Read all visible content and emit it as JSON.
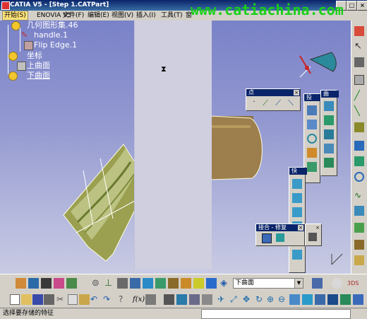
{
  "window": {
    "title": "CATIA V5 - [Step 1.CATPart]",
    "watermark": "www.catiachina.com"
  },
  "menu": {
    "items": [
      "开始(S)",
      "ENOVIA V5",
      "文件(F)",
      "编辑(E)",
      "视图(V)",
      "插入(I)",
      "工具(T)",
      "窗"
    ],
    "active_index": 0
  },
  "tree": {
    "items": [
      {
        "label": "几何图形集.46",
        "icon": "geometric-set-icon"
      },
      {
        "label": "handle.1",
        "icon": "curve-icon"
      },
      {
        "label": "Flip Edge.1",
        "icon": "flip-edge-icon"
      },
      {
        "label": "坐标",
        "icon": "axis-system-icon"
      },
      {
        "label": "上曲面",
        "icon": "surface-icon"
      },
      {
        "label": "下曲面",
        "icon": "surface-icon"
      }
    ]
  },
  "toolbars": {
    "point": {
      "title": "点"
    },
    "geo": {
      "title": "曲"
    },
    "mid": {
      "title": "投"
    },
    "quick": {
      "title": "快"
    },
    "join": {
      "title": "接合 - 修复"
    }
  },
  "current_body": "下曲面",
  "status": {
    "text": "选择要存储的特征"
  },
  "colors": {
    "viewport_top": "#7a82c8",
    "plane": "#d0cfe0",
    "surface": "#8c7040",
    "selected_edge": "#fffde0"
  }
}
